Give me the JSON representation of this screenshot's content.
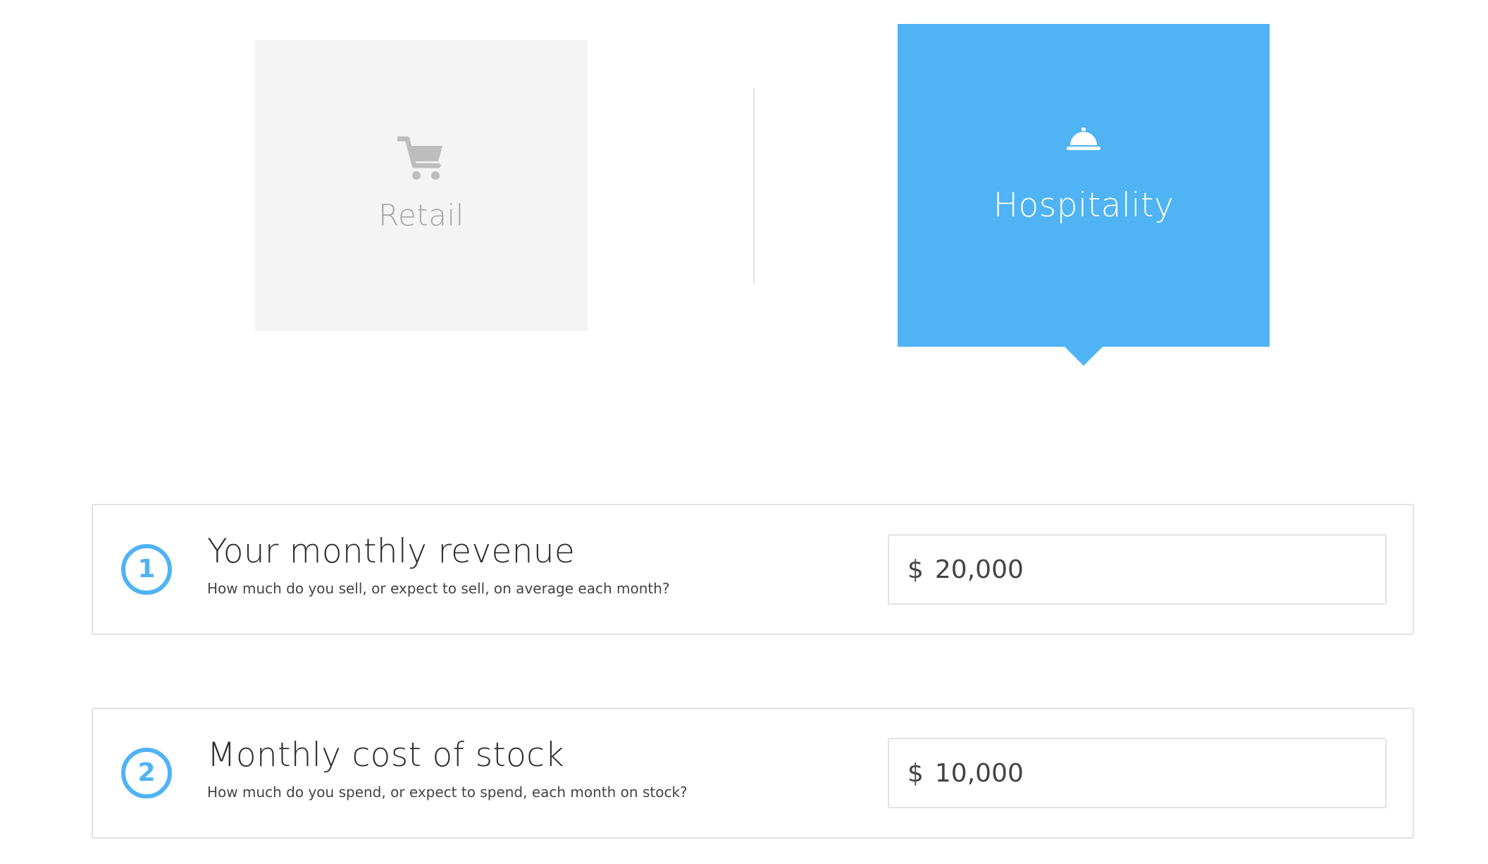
{
  "business_type": {
    "options": [
      {
        "label": "Retail",
        "icon": "shopping-cart-icon",
        "selected": false
      },
      {
        "label": "Hospitality",
        "icon": "service-bell-icon",
        "selected": true
      }
    ],
    "colors": {
      "selected_bg": "#4fb3f4",
      "unselected_bg": "#f4f4f4",
      "unselected_text": "#a6a6a6"
    }
  },
  "questions": [
    {
      "step": "1",
      "title": "Your monthly revenue",
      "subtitle": "How much do you sell, or expect to sell, on average each month?",
      "currency": "$",
      "value": "20,000"
    },
    {
      "step": "2",
      "title": "Monthly cost of stock",
      "subtitle": "How much do you spend, or expect to spend, each month on stock?",
      "currency": "$",
      "value": "10,000"
    }
  ],
  "accent_color": "#4fb3f4"
}
